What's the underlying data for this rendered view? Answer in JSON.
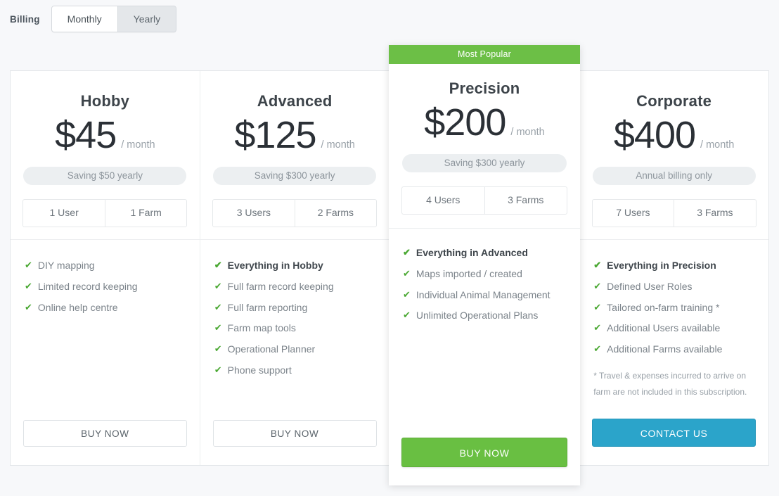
{
  "billing": {
    "label": "Billing",
    "options": [
      "Monthly",
      "Yearly"
    ],
    "selected": "Monthly"
  },
  "colors": {
    "green": "#6cbf46",
    "blue": "#2ba4ca",
    "check": "#4aa832",
    "page_bg": "#f7f8fa"
  },
  "badge": {
    "text": "Most Popular"
  },
  "plans": [
    {
      "name": "Hobby",
      "price": "$45",
      "per": "/ month",
      "note": "Saving $50 yearly",
      "users": "1 User",
      "farms": "1 Farm",
      "features": [
        {
          "text": "DIY mapping",
          "bold": false
        },
        {
          "text": "Limited record keeping",
          "bold": false
        },
        {
          "text": "Online help centre",
          "bold": false
        }
      ],
      "footnote": "",
      "cta": "BUY NOW",
      "cta_style": "outline"
    },
    {
      "name": "Advanced",
      "price": "$125",
      "per": "/ month",
      "note": "Saving $300 yearly",
      "users": "3 Users",
      "farms": "2 Farms",
      "features": [
        {
          "text": "Everything in Hobby",
          "bold": true
        },
        {
          "text": "Full farm record keeping",
          "bold": false
        },
        {
          "text": "Full farm reporting",
          "bold": false
        },
        {
          "text": "Farm map tools",
          "bold": false
        },
        {
          "text": "Operational Planner",
          "bold": false
        },
        {
          "text": "Phone support",
          "bold": false
        }
      ],
      "footnote": "",
      "cta": "BUY NOW",
      "cta_style": "outline"
    },
    {
      "name": "Precision",
      "price": "$200",
      "per": "/ month",
      "note": "Saving $300 yearly",
      "users": "4 Users",
      "farms": "3 Farms",
      "features": [
        {
          "text": "Everything in Advanced",
          "bold": true
        },
        {
          "text": "Maps imported / created",
          "bold": false
        },
        {
          "text": "Individual Animal Management",
          "bold": false
        },
        {
          "text": "Unlimited Operational Plans",
          "bold": false
        }
      ],
      "footnote": "",
      "cta": "BUY NOW",
      "cta_style": "green",
      "featured": true
    },
    {
      "name": "Corporate",
      "price": "$400",
      "per": "/ month",
      "note": "Annual billing only",
      "users": "7 Users",
      "farms": "3 Farms",
      "features": [
        {
          "text": "Everything in Precision",
          "bold": true
        },
        {
          "text": "Defined User Roles",
          "bold": false
        },
        {
          "text": "Tailored on-farm training *",
          "bold": false
        },
        {
          "text": "Additional Users available",
          "bold": false
        },
        {
          "text": "Additional Farms available",
          "bold": false
        }
      ],
      "footnote": "* Travel & expenses incurred to arrive on farm are not included in this subscription.",
      "cta": "CONTACT US",
      "cta_style": "blue"
    }
  ],
  "icons": {
    "check": "✔"
  }
}
